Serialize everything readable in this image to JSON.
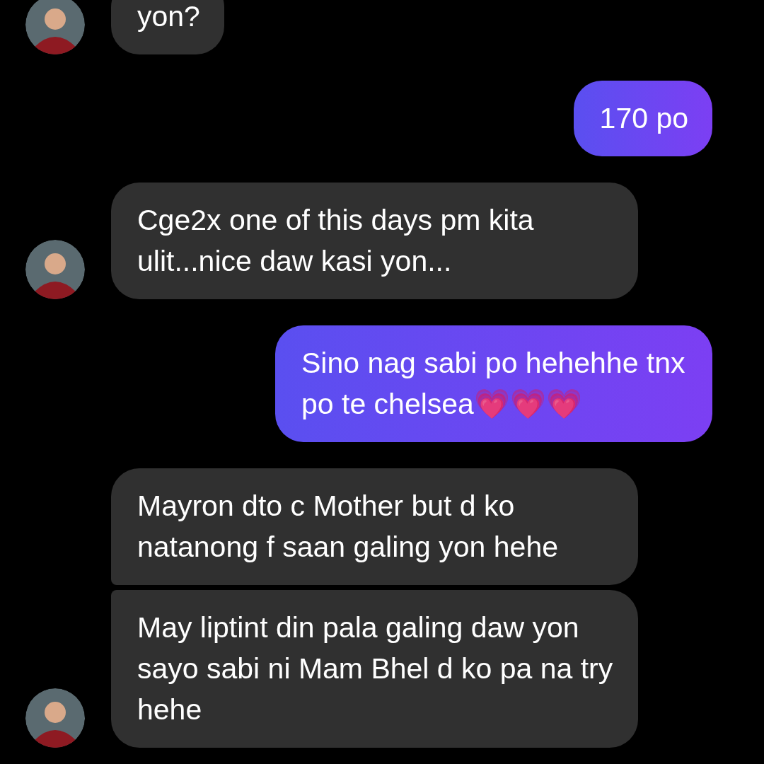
{
  "messages": [
    {
      "kind": "received",
      "text": "yon?",
      "avatar": true
    },
    {
      "kind": "sent",
      "text": "170 po",
      "avatar": false
    },
    {
      "kind": "received",
      "text": "Cge2x one of this days pm kita ulit...nice daw kasi yon...",
      "avatar": true
    },
    {
      "kind": "sent",
      "text": "Sino nag sabi po hehehhe tnx po te chelsea💗💗💗",
      "avatar": false
    },
    {
      "kind": "received",
      "text": "Mayron dto c Mother but d ko natanong f saan galing yon hehe",
      "avatar": false
    },
    {
      "kind": "received",
      "text": "May liptint din pala galing daw yon sayo sabi ni Mam Bhel d ko pa na try hehe",
      "avatar": true
    }
  ]
}
